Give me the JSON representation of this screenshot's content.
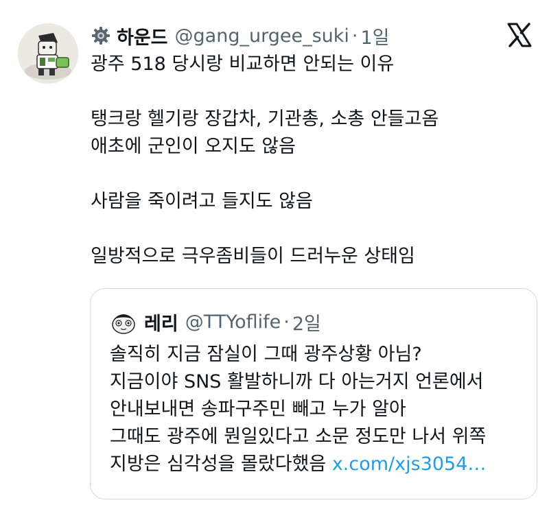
{
  "tweet": {
    "author": {
      "name": "하운드",
      "handle": "@gang_urgee_suki",
      "separator": "·",
      "time": "1일"
    },
    "lines": [
      "광주 518 당시랑 비교하면 안되는 이유",
      "",
      "탱크랑 헬기랑 장갑차, 기관총, 소총 안들고옴",
      "애초에 군인이 오지도 않음",
      "",
      "사람을 죽이려고 들지도 않음",
      "",
      "일방적으로 극우좀비들이 드러누운 상태임"
    ]
  },
  "quote": {
    "author": {
      "name": "레리",
      "handle": "@TTYoflife",
      "separator": "·",
      "time": "2일"
    },
    "lines": [
      "솔직히 지금 잠실이 그때 광주상황 아님?",
      "지금이야 SNS 활발하니까 다 아는거지 언론에서",
      "안내보내면 송파구주민 빼고 누가 알아",
      "그때도 광주에 뭔일있다고 소문 정도만 나서 위쪽"
    ],
    "last_line_text": "지방은 심각성을 몰랐다했음 ",
    "link_text": "x.com/xjs3054…"
  },
  "colors": {
    "text": "#0f1419",
    "muted": "#536471",
    "link": "#1d9bf0",
    "border": "#cfd9de"
  },
  "icons": {
    "name_badge": "gear-icon",
    "platform": "x-logo-icon"
  }
}
